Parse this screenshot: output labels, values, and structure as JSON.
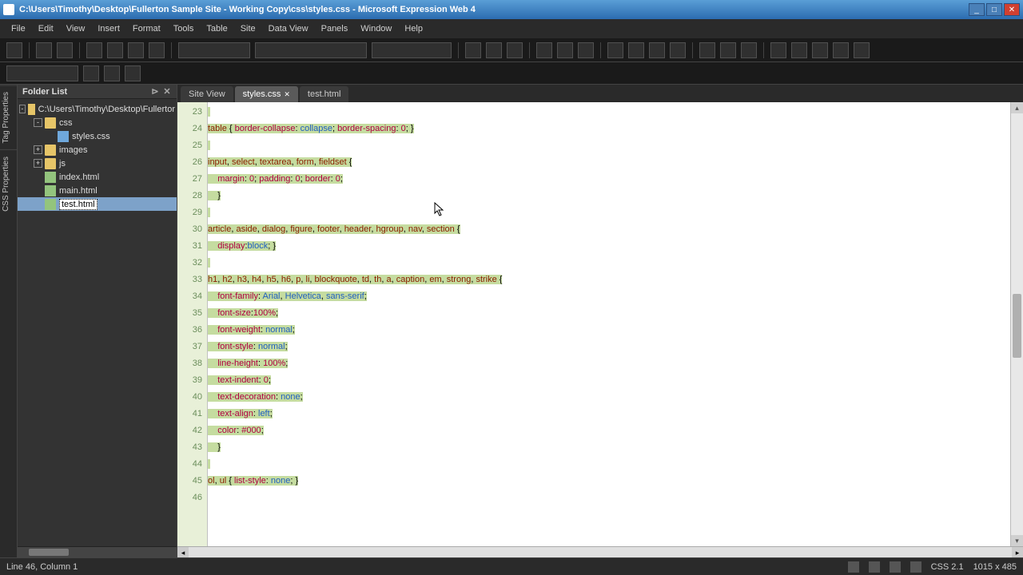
{
  "window": {
    "title": "C:\\Users\\Timothy\\Desktop\\Fullerton Sample Site - Working Copy\\css\\styles.css - Microsoft Expression Web 4"
  },
  "menu": [
    "File",
    "Edit",
    "View",
    "Insert",
    "Format",
    "Tools",
    "Table",
    "Site",
    "Data View",
    "Panels",
    "Window",
    "Help"
  ],
  "sidetabs": [
    "Tag Properties",
    "CSS Properties"
  ],
  "folder": {
    "title": "Folder List",
    "root": "C:\\Users\\Timothy\\Desktop\\Fullertor",
    "items": [
      {
        "label": "css",
        "type": "folder",
        "depth": 1,
        "exp": "-"
      },
      {
        "label": "styles.css",
        "type": "css",
        "depth": 2,
        "exp": ""
      },
      {
        "label": "images",
        "type": "folder",
        "depth": 1,
        "exp": "+"
      },
      {
        "label": "js",
        "type": "folder",
        "depth": 1,
        "exp": "+"
      },
      {
        "label": "index.html",
        "type": "html",
        "depth": 1,
        "exp": ""
      },
      {
        "label": "main.html",
        "type": "html",
        "depth": 1,
        "exp": ""
      },
      {
        "label": "test.html",
        "type": "html",
        "depth": 1,
        "exp": "",
        "selected": true
      }
    ]
  },
  "tabs": [
    {
      "label": "Site View",
      "active": false,
      "closable": false
    },
    {
      "label": "styles.css",
      "active": true,
      "closable": true
    },
    {
      "label": "test.html",
      "active": false,
      "closable": false
    }
  ],
  "gutter_start": 23,
  "gutter_end": 46,
  "code": [
    {
      "sel": true,
      "html": ""
    },
    {
      "sel": true,
      "html": "<span class='tag'>table</span> { <span class='prop'>border-collapse</span>: <span class='val'>collapse</span>; <span class='prop'>border-spacing</span>: <span class='num'>0</span>; }"
    },
    {
      "sel": true,
      "html": ""
    },
    {
      "sel": true,
      "html": "<span class='tag'>input</span>, <span class='tag'>select</span>, <span class='tag'>textarea</span>, <span class='tag'>form</span>, <span class='tag'>fieldset</span> {"
    },
    {
      "sel": true,
      "html": "    <span class='prop'>margin</span>: <span class='num'>0</span>; <span class='prop'>padding</span>: <span class='num'>0</span>; <span class='prop'>border</span>: <span class='num'>0</span>;"
    },
    {
      "sel": true,
      "html": "    }"
    },
    {
      "sel": true,
      "html": ""
    },
    {
      "sel": true,
      "html": "<span class='tag'>article</span>, <span class='tag'>aside</span>, <span class='tag'>dialog</span>, <span class='tag'>figure</span>, <span class='tag'>footer</span>, <span class='tag'>header</span>, <span class='tag'>hgroup</span>, <span class='tag'>nav</span>, <span class='tag'>section</span> {"
    },
    {
      "sel": true,
      "html": "    <span class='prop'>display</span>:<span class='val'>block</span>; }"
    },
    {
      "sel": true,
      "html": ""
    },
    {
      "sel": true,
      "html": "<span class='tag'>h1</span>, <span class='tag'>h2</span>, <span class='tag'>h3</span>, <span class='tag'>h4</span>, <span class='tag'>h5</span>, <span class='tag'>h6</span>, <span class='tag'>p</span>, <span class='tag'>li</span>, <span class='tag'>blockquote</span>, <span class='tag'>td</span>, <span class='tag'>th</span>, <span class='tag'>a</span>, <span class='tag'>caption</span>, <span class='tag'>em</span>, <span class='tag'>strong</span>, <span class='tag'>strike</span> {"
    },
    {
      "sel": true,
      "html": "    <span class='prop'>font-family</span>: <span class='val'>Arial</span>, <span class='val'>Helvetica</span>, <span class='val'>sans-serif</span>;"
    },
    {
      "sel": true,
      "html": "    <span class='prop'>font-size</span>:<span class='num'>100%</span>;"
    },
    {
      "sel": true,
      "html": "    <span class='prop'>font-weight</span>: <span class='val'>normal</span>;"
    },
    {
      "sel": true,
      "html": "    <span class='prop'>font-style</span>: <span class='val'>normal</span>;"
    },
    {
      "sel": true,
      "html": "    <span class='prop'>line-height</span>: <span class='num'>100%</span>;"
    },
    {
      "sel": true,
      "html": "    <span class='prop'>text-indent</span>: <span class='num'>0</span>;"
    },
    {
      "sel": true,
      "html": "    <span class='prop'>text-decoration</span>: <span class='val'>none</span>;"
    },
    {
      "sel": true,
      "html": "    <span class='prop'>text-align</span>: <span class='val'>left</span>;"
    },
    {
      "sel": true,
      "html": "    <span class='prop'>color</span>: <span class='num'>#000</span>;"
    },
    {
      "sel": true,
      "html": "    }"
    },
    {
      "sel": true,
      "html": ""
    },
    {
      "sel": true,
      "html": "<span class='tag'>ol</span>, <span class='tag'>ul</span> { <span class='prop'>list-style</span>: <span class='val'>none</span>; }"
    },
    {
      "sel": false,
      "html": ""
    }
  ],
  "status": {
    "left": "Line 46, Column 1",
    "mode": "CSS 2.1",
    "dims": "1015 x 485"
  }
}
